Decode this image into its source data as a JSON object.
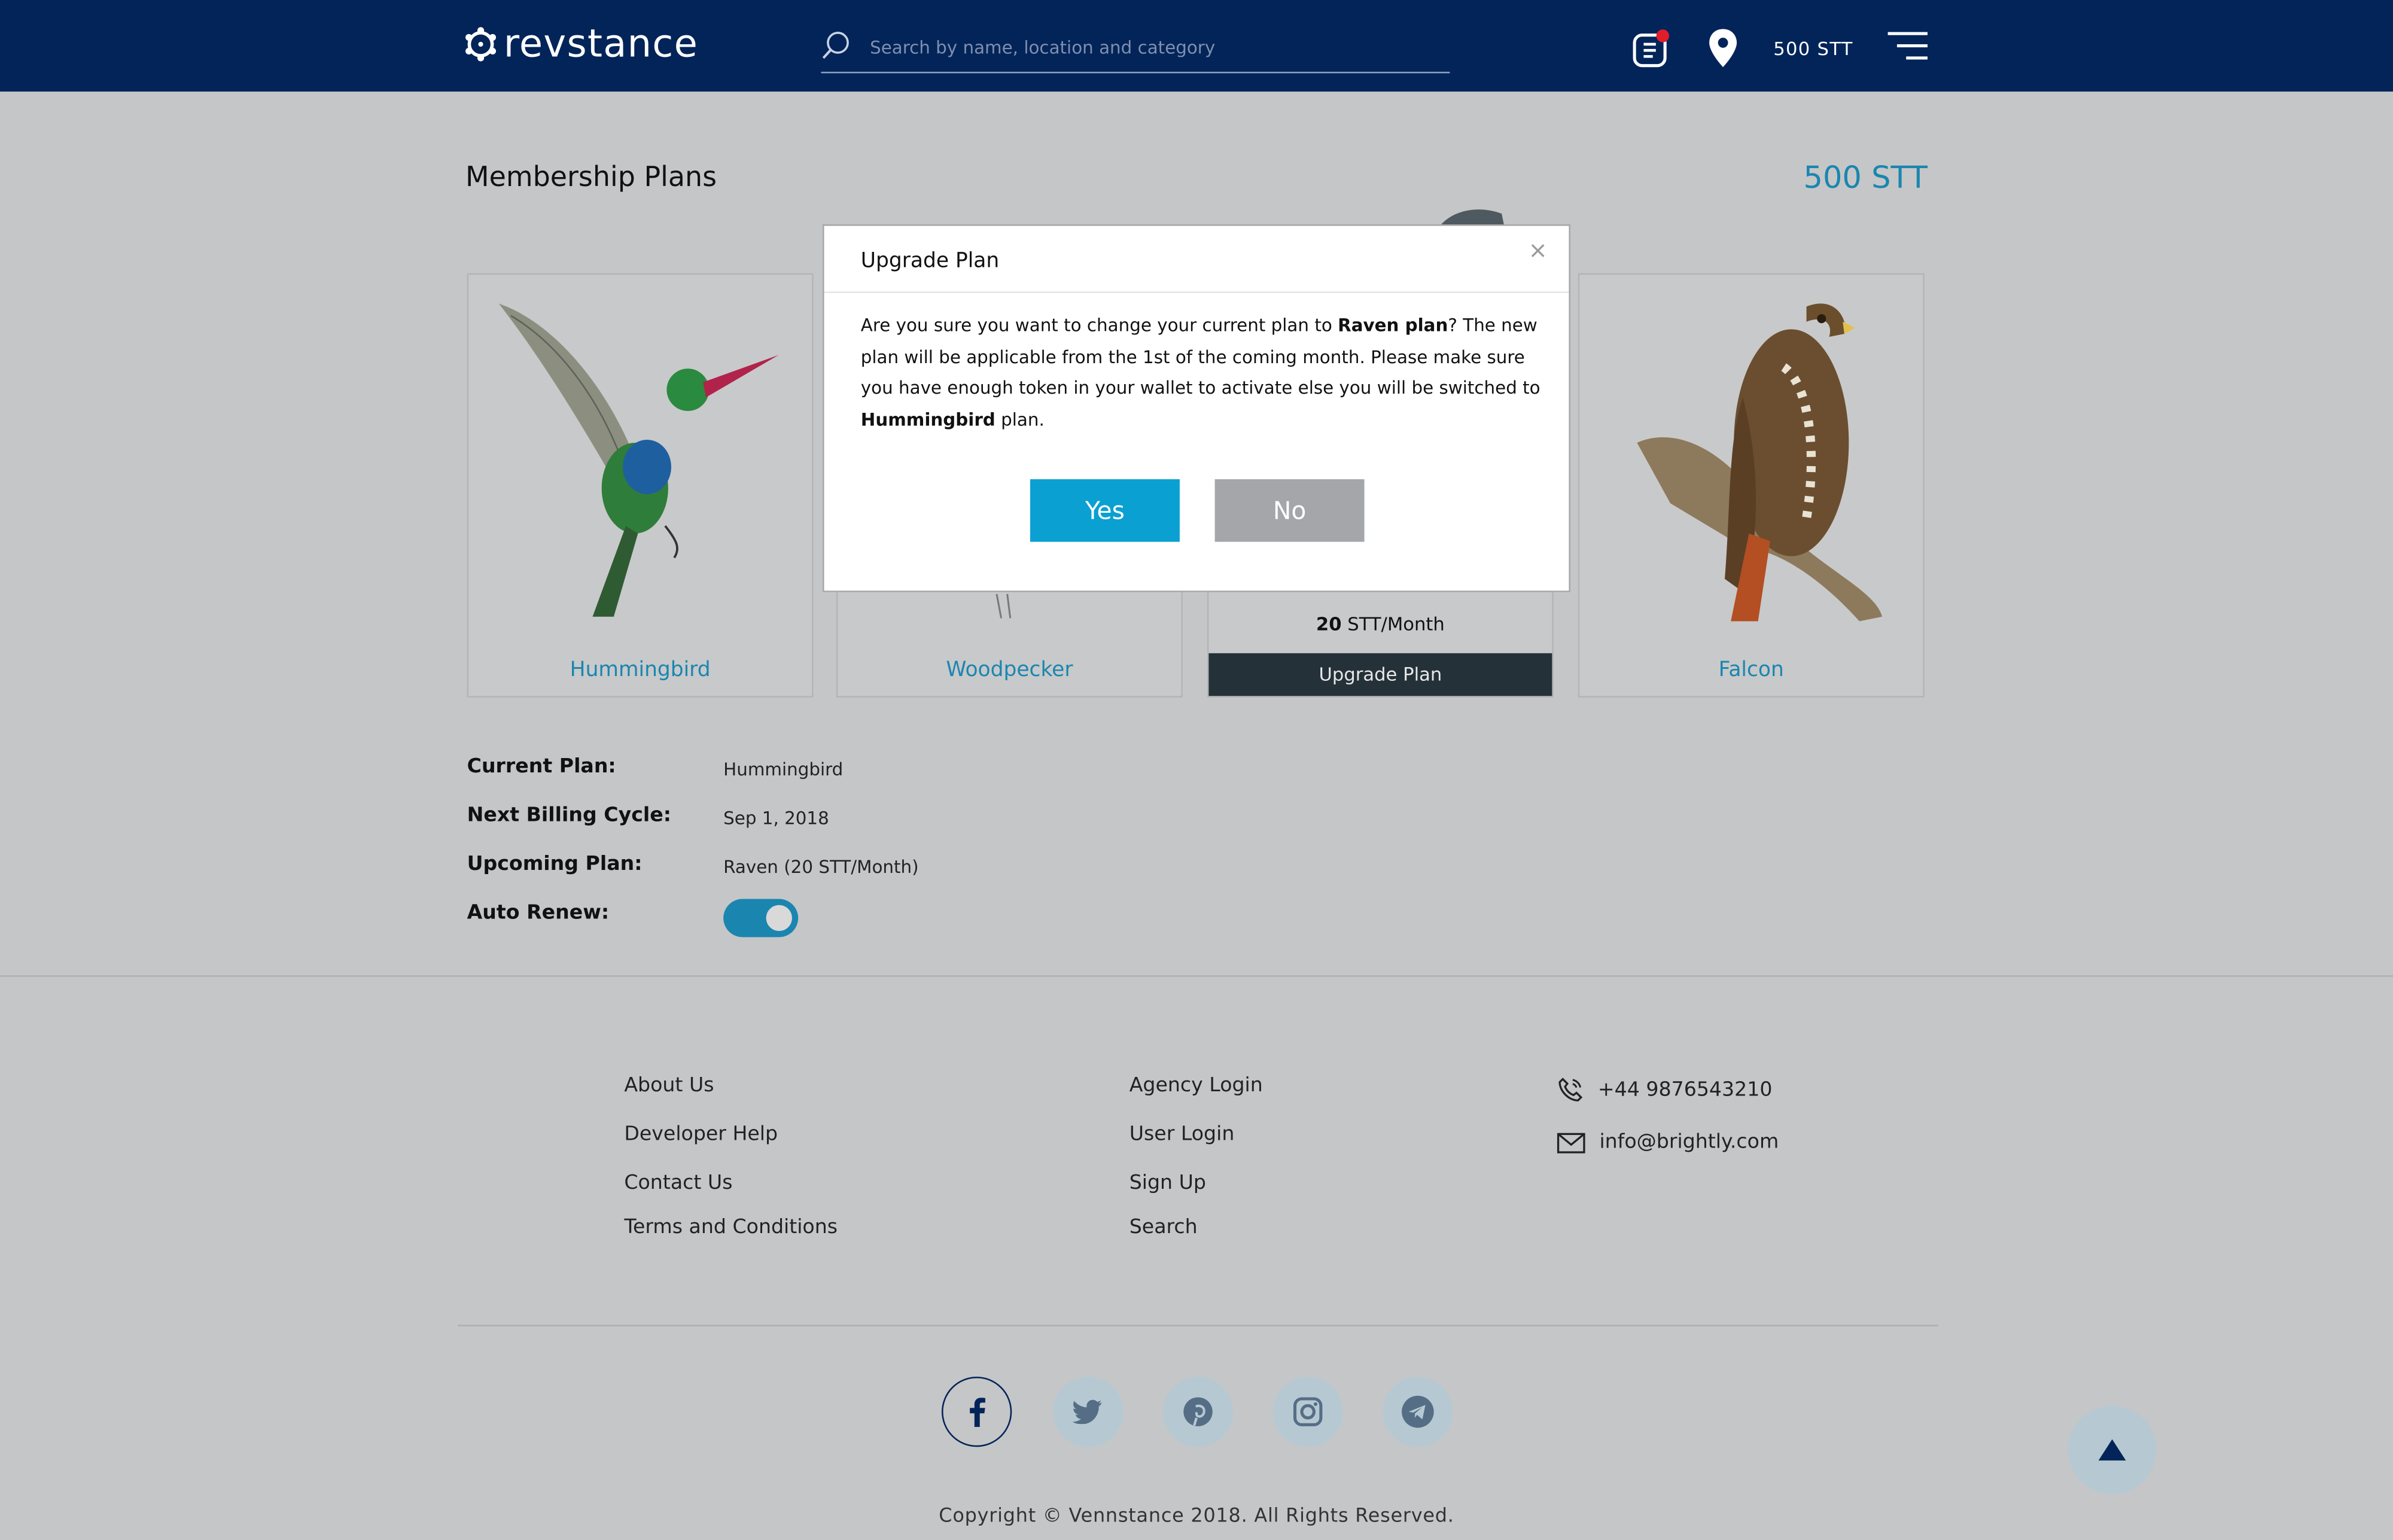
{
  "header": {
    "logo_text": "revstance",
    "search_placeholder": "Search by name, location and category",
    "balance": "500 STT"
  },
  "page": {
    "title": "Membership Plans",
    "balance": "500 STT"
  },
  "plans": [
    {
      "name": "Hummingbird"
    },
    {
      "name": "Woodpecker"
    },
    {
      "name": "Raven",
      "price_value": "20",
      "price_unit": " STT/Month",
      "upgrade_label": "Upgrade Plan"
    },
    {
      "name": "Falcon"
    }
  ],
  "info": {
    "current_plan_label": "Current Plan:",
    "current_plan": "Hummingbird",
    "next_billing_label": "Next Billing Cycle:",
    "next_billing": "Sep 1, 2018",
    "upcoming_plan_label": "Upcoming Plan:",
    "upcoming_plan": "Raven (20 STT/Month)",
    "auto_renew_label": "Auto Renew:",
    "auto_renew": true
  },
  "footer": {
    "col1": [
      "About Us",
      "Developer Help",
      "Contact Us",
      "Terms and Conditions"
    ],
    "col2": [
      "Agency Login",
      "User Login",
      "Sign Up",
      "Search"
    ],
    "phone": "+44 9876543210",
    "email": "info@brightly.com",
    "social_icons": [
      "facebook-icon",
      "twitter-icon",
      "pinterest-icon",
      "instagram-icon",
      "telegram-icon"
    ],
    "copyright": "Copyright © Vennstance 2018. All Rights Reserved."
  },
  "modal": {
    "title": "Upgrade Plan",
    "close": "×",
    "text_1": "Are you sure you want to change your current plan to ",
    "plan_bold": "Raven plan",
    "text_2": "? The new plan will be applicable from the 1st of the coming month. Please make sure you have enough token in your wallet to activate else you will be switched to ",
    "fallback_bold": "Hummingbird",
    "text_3": " plan.",
    "yes": "Yes",
    "no": "No"
  },
  "colors": {
    "header_bg": "#022459",
    "accent": "#1a86b0",
    "yes_button": "#0aa0d2",
    "no_button": "#a4a6aa",
    "overlay_bg": "#c5c6c7"
  }
}
